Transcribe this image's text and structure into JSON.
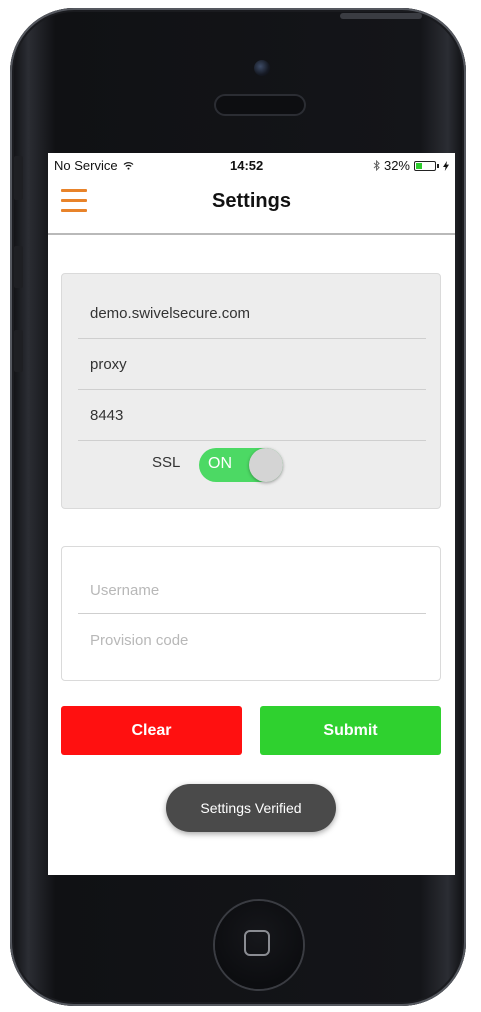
{
  "status_bar": {
    "carrier": "No Service",
    "wifi_icon": "wifi-icon",
    "time": "14:52",
    "bluetooth_icon": "bluetooth-icon",
    "battery_percent": "32%",
    "battery_level": 0.32,
    "battery_icon": "battery-icon",
    "charging_icon": "charging-bolt-icon"
  },
  "nav": {
    "title": "Settings",
    "menu_icon": "hamburger-menu-icon",
    "accent_color": "#e8832a"
  },
  "server": {
    "host": "demo.swivelsecure.com",
    "path": "proxy",
    "port": "8443",
    "ssl_label": "SSL",
    "ssl_toggle": "ON",
    "ssl_on_color": "#4cd964"
  },
  "credentials": {
    "username_placeholder": "Username",
    "provision_placeholder": "Provision code"
  },
  "actions": {
    "clear_label": "Clear",
    "clear_color": "#ff1010",
    "submit_label": "Submit",
    "submit_color": "#2fd12f"
  },
  "toast": {
    "message": "Settings Verified"
  }
}
